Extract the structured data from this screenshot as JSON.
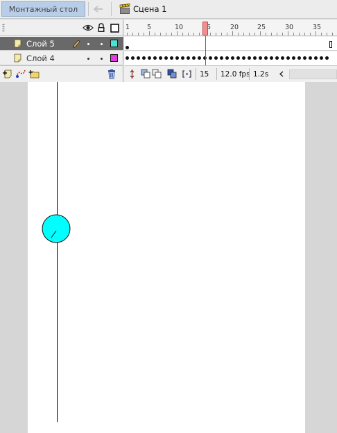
{
  "topbar": {
    "stage_label": "Монтажный стол",
    "back_icon": "arrow-left-icon",
    "scene_icon": "clapperboard-icon",
    "scene_label": "Сцена 1"
  },
  "timeline": {
    "header_icons": [
      "eye-icon",
      "lock-icon",
      "outline-icon"
    ],
    "layers": [
      {
        "name": "Слой 5",
        "selected": true,
        "outline_color": "#4fe0d4",
        "editing_icon": "pencil-icon"
      },
      {
        "name": "Слой 4",
        "selected": false,
        "outline_color": "#e23ce0"
      }
    ],
    "ruler_labels": [
      "1",
      "5",
      "10",
      "15",
      "20",
      "25",
      "30",
      "35"
    ],
    "current_frame": "15",
    "fps": "12.0 fps",
    "time": "1.2s",
    "tool_icons": [
      "add-layer-icon",
      "add-motion-guide-icon",
      "insert-folder-icon",
      "delete-layer-icon"
    ],
    "status_icons": [
      "center-frame-icon",
      "onion-skin-icon",
      "onion-outlines-icon",
      "edit-multiple-frames-icon",
      "modify-onion-markers-icon",
      "scroll-left-icon"
    ]
  },
  "stage": {
    "background": "#ffffff",
    "pasteboard": "#d6d6d6",
    "ball_color": "#00ffff",
    "line_color": "#000000"
  }
}
